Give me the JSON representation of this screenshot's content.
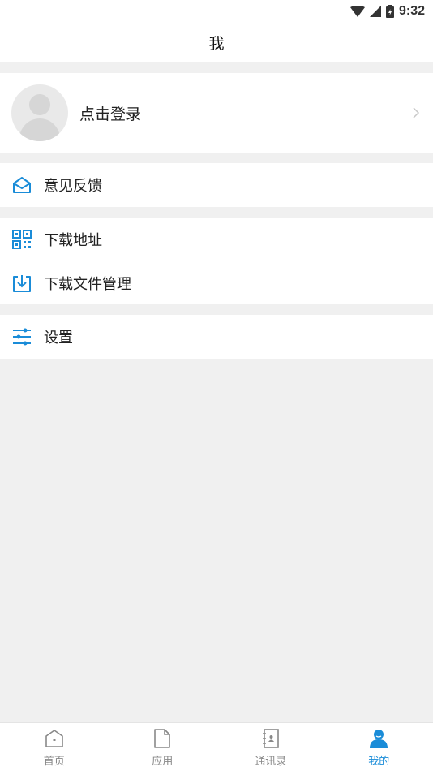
{
  "status_bar": {
    "time": "9:32"
  },
  "header": {
    "title": "我"
  },
  "profile": {
    "login_label": "点击登录"
  },
  "menu": {
    "feedback": "意见反馈",
    "download_address": "下载地址",
    "download_file_management": "下载文件管理",
    "settings": "设置"
  },
  "tabs": [
    {
      "label": "首页",
      "icon": "home-icon"
    },
    {
      "label": "应用",
      "icon": "document-icon"
    },
    {
      "label": "通讯录",
      "icon": "contacts-icon"
    },
    {
      "label": "我的",
      "icon": "person-icon"
    }
  ],
  "colors": {
    "accent": "#1a8cd8",
    "background": "#f0f0f0"
  }
}
